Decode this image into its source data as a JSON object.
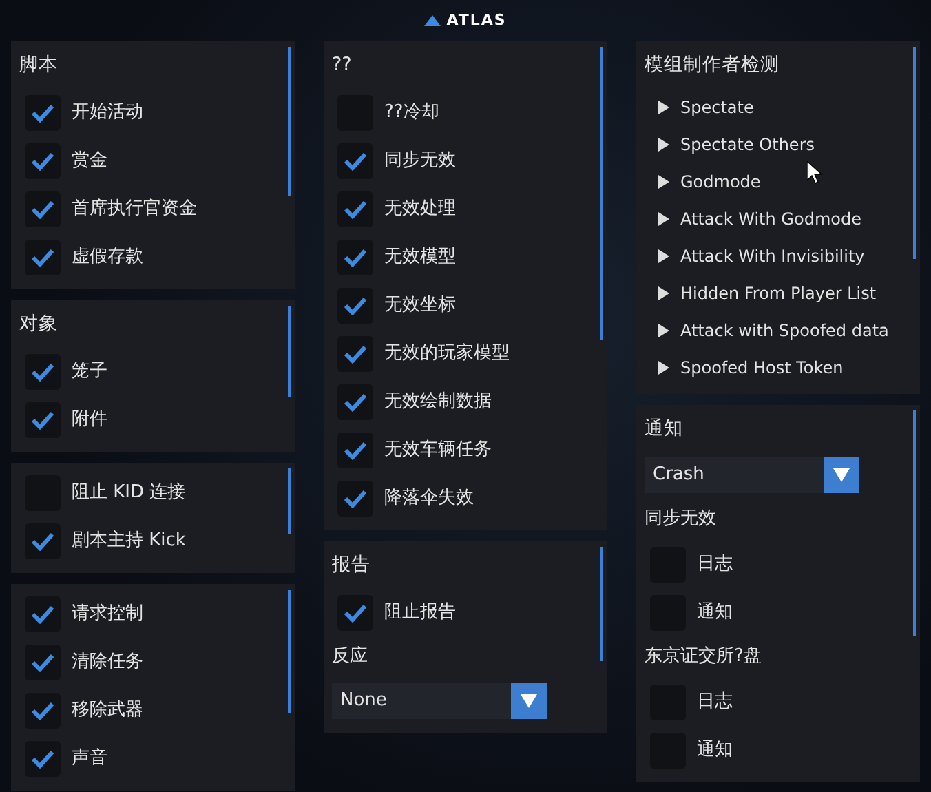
{
  "header": {
    "logo": "ATLAS"
  },
  "columns": [
    {
      "panels": [
        {
          "title": "脚本",
          "rows": [
            {
              "kind": "checkbox",
              "label": "开始活动",
              "checked": true
            },
            {
              "kind": "checkbox",
              "label": "赏金",
              "checked": true
            },
            {
              "kind": "checkbox",
              "label": "首席执行官资金",
              "checked": true
            },
            {
              "kind": "checkbox",
              "label": "虚假存款",
              "checked": true
            }
          ]
        },
        {
          "title": "对象",
          "rows": [
            {
              "kind": "checkbox",
              "label": "笼子",
              "checked": true
            },
            {
              "kind": "checkbox",
              "label": "附件",
              "checked": true
            }
          ]
        },
        {
          "rows": [
            {
              "kind": "checkbox",
              "label": "阻止 KID 连接",
              "checked": false
            },
            {
              "kind": "checkbox",
              "label": "剧本主持 Kick",
              "checked": true
            }
          ]
        },
        {
          "rows": [
            {
              "kind": "checkbox",
              "label": "请求控制",
              "checked": true
            },
            {
              "kind": "checkbox",
              "label": "清除任务",
              "checked": true
            },
            {
              "kind": "checkbox",
              "label": "移除武器",
              "checked": true
            },
            {
              "kind": "checkbox",
              "label": "声音",
              "checked": true
            }
          ]
        }
      ]
    },
    {
      "panels": [
        {
          "title": "??",
          "rows": [
            {
              "kind": "checkbox",
              "label": "??冷却",
              "checked": false
            },
            {
              "kind": "checkbox",
              "label": "同步无效",
              "checked": true
            },
            {
              "kind": "checkbox",
              "label": "无效处理",
              "checked": true
            },
            {
              "kind": "checkbox",
              "label": "无效模型",
              "checked": true
            },
            {
              "kind": "checkbox",
              "label": "无效坐标",
              "checked": true
            },
            {
              "kind": "checkbox",
              "label": "无效的玩家模型",
              "checked": true
            },
            {
              "kind": "checkbox",
              "label": "无效绘制数据",
              "checked": true
            },
            {
              "kind": "checkbox",
              "label": "无效车辆任务",
              "checked": true
            },
            {
              "kind": "checkbox",
              "label": "降落伞失效",
              "checked": true
            }
          ]
        },
        {
          "title": "报告",
          "rows": [
            {
              "kind": "checkbox",
              "label": "阻止报告",
              "checked": true
            },
            {
              "kind": "heading",
              "label": "反应"
            },
            {
              "kind": "dropdown",
              "value": "None"
            }
          ]
        }
      ]
    },
    {
      "panels": [
        {
          "title": "模组制作者检测",
          "rows": [
            {
              "kind": "tree",
              "label": "Spectate",
              "expanded": false
            },
            {
              "kind": "tree",
              "label": "Spectate Others",
              "expanded": false
            },
            {
              "kind": "tree",
              "label": "Godmode",
              "expanded": false
            },
            {
              "kind": "tree",
              "label": "Attack With Godmode",
              "expanded": false
            },
            {
              "kind": "tree",
              "label": "Attack With Invisibility",
              "expanded": false
            },
            {
              "kind": "tree",
              "label": "Hidden From Player List",
              "expanded": false
            },
            {
              "kind": "tree",
              "label": "Attack with Spoofed data",
              "expanded": false
            },
            {
              "kind": "tree",
              "label": "Spoofed Host Token",
              "expanded": false
            }
          ]
        },
        {
          "title": "通知",
          "rows": [
            {
              "kind": "dropdown",
              "value": "Crash"
            },
            {
              "kind": "heading",
              "label": "同步无效"
            },
            {
              "kind": "checkbox",
              "label": "日志",
              "checked": false
            },
            {
              "kind": "checkbox",
              "label": "通知",
              "checked": false
            },
            {
              "kind": "heading",
              "label": "东京证交所?盘"
            },
            {
              "kind": "checkbox",
              "label": "日志",
              "checked": false
            },
            {
              "kind": "checkbox",
              "label": "通知",
              "checked": false
            }
          ]
        }
      ]
    }
  ]
}
